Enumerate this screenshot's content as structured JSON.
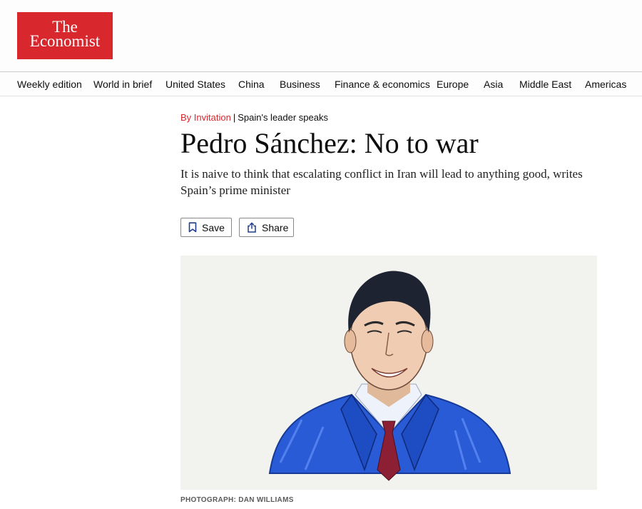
{
  "masthead": {
    "logo_line1": "The",
    "logo_line2": "Economist",
    "brand_color": "#d9272e"
  },
  "nav": {
    "items": [
      "Weekly edition",
      "World in brief",
      "United States",
      "China",
      "Business",
      "Finance & economics",
      "Europe",
      "Asia",
      "Middle East",
      "Americas"
    ]
  },
  "article": {
    "section": "By Invitation",
    "separator": "|",
    "series": "Spain's leader speaks",
    "headline": "Pedro Sánchez: No to war",
    "standfirst": "It is naive to think that escalating conflict in Iran will lead to anything good, writes Spain’s prime minister",
    "save_label": "Save",
    "share_label": "Share",
    "image_caption": "PHOTOGRAPH: DAN WILLIAMS"
  },
  "icons": {
    "save": "bookmark-icon",
    "share": "share-icon"
  }
}
